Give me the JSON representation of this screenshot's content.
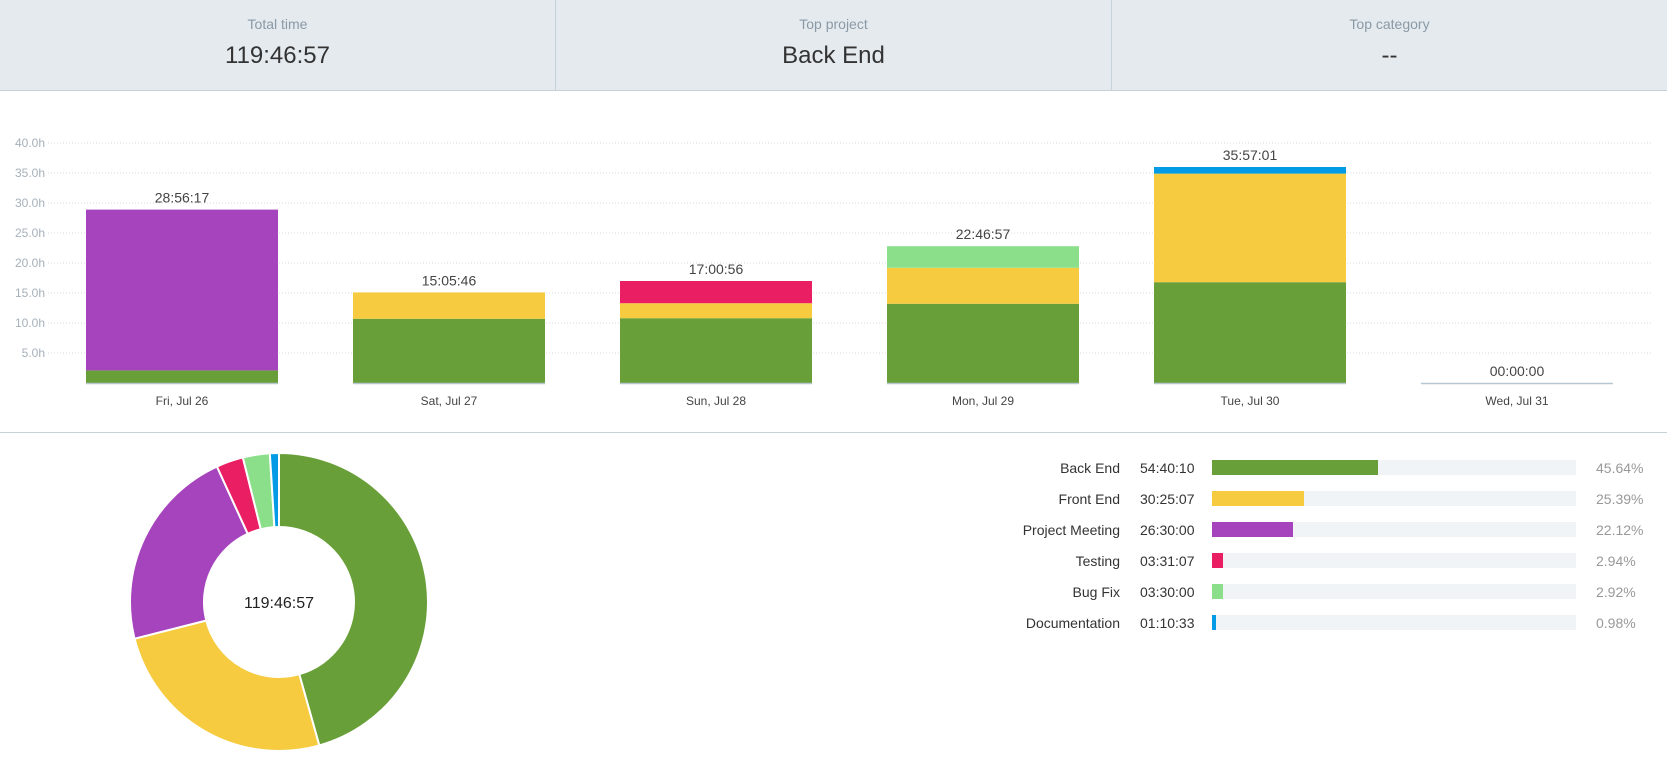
{
  "summary": {
    "total_label": "Total time",
    "total_value": "119:46:57",
    "project_label": "Top project",
    "project_value": "Back End",
    "category_label": "Top category",
    "category_value": "--"
  },
  "colors": {
    "back_end": "#689f38",
    "front_end": "#f6cb40",
    "project_meeting": "#a644bd",
    "testing": "#e91e63",
    "bug_fix": "#8bdf8b",
    "documentation": "#039be5"
  },
  "chart_data": [
    {
      "type": "bar",
      "stacked": true,
      "categories": [
        "Fri, Jul 26",
        "Sat, Jul 27",
        "Sun, Jul 28",
        "Mon, Jul 29",
        "Tue, Jul 30",
        "Wed, Jul 31"
      ],
      "totals": [
        "28:56:17",
        "15:05:46",
        "17:00:56",
        "22:46:57",
        "35:57:01",
        "00:00:00"
      ],
      "yticks": [
        "5.0h",
        "10.0h",
        "15.0h",
        "20.0h",
        "25.0h",
        "30.0h",
        "35.0h",
        "40.0h"
      ],
      "ylim": [
        0,
        40
      ],
      "grid": true,
      "series": [
        {
          "name": "Back End",
          "color": "#689f38",
          "values": [
            2.1,
            10.7,
            10.8,
            13.2,
            16.8,
            0
          ]
        },
        {
          "name": "Front End",
          "color": "#f6cb40",
          "values": [
            0,
            4.4,
            2.5,
            6.0,
            18.1,
            0
          ]
        },
        {
          "name": "Project Meeting",
          "color": "#a644bd",
          "values": [
            26.8,
            0,
            0,
            0,
            0,
            0
          ]
        },
        {
          "name": "Testing",
          "color": "#e91e63",
          "values": [
            0,
            0,
            3.7,
            0,
            0,
            0
          ]
        },
        {
          "name": "Bug Fix",
          "color": "#8bdf8b",
          "values": [
            0,
            0,
            0,
            3.6,
            0,
            0
          ]
        },
        {
          "name": "Documentation",
          "color": "#039be5",
          "values": [
            0,
            0,
            0,
            0,
            1.1,
            0
          ]
        }
      ]
    },
    {
      "type": "pie",
      "donut": true,
      "center_label": "119:46:57",
      "slices": [
        {
          "name": "Back End",
          "value": 45.64,
          "color": "#689f38"
        },
        {
          "name": "Front End",
          "value": 25.39,
          "color": "#f6cb40"
        },
        {
          "name": "Project Meeting",
          "value": 22.12,
          "color": "#a644bd"
        },
        {
          "name": "Testing",
          "value": 2.94,
          "color": "#e91e63"
        },
        {
          "name": "Bug Fix",
          "value": 2.92,
          "color": "#8bdf8b"
        },
        {
          "name": "Documentation",
          "value": 0.98,
          "color": "#039be5"
        }
      ]
    }
  ],
  "legend": [
    {
      "name": "Back End",
      "time": "54:40:10",
      "pct": "45.64%",
      "fraction": 0.4564,
      "color": "#689f38"
    },
    {
      "name": "Front End",
      "time": "30:25:07",
      "pct": "25.39%",
      "fraction": 0.2539,
      "color": "#f6cb40"
    },
    {
      "name": "Project Meeting",
      "time": "26:30:00",
      "pct": "22.12%",
      "fraction": 0.2212,
      "color": "#a644bd"
    },
    {
      "name": "Testing",
      "time": "03:31:07",
      "pct": "2.94%",
      "fraction": 0.0294,
      "color": "#e91e63"
    },
    {
      "name": "Bug Fix",
      "time": "03:30:00",
      "pct": "2.92%",
      "fraction": 0.0292,
      "color": "#8bdf8b"
    },
    {
      "name": "Documentation",
      "time": "01:10:33",
      "pct": "0.98%",
      "fraction": 0.0098,
      "color": "#039be5"
    }
  ]
}
